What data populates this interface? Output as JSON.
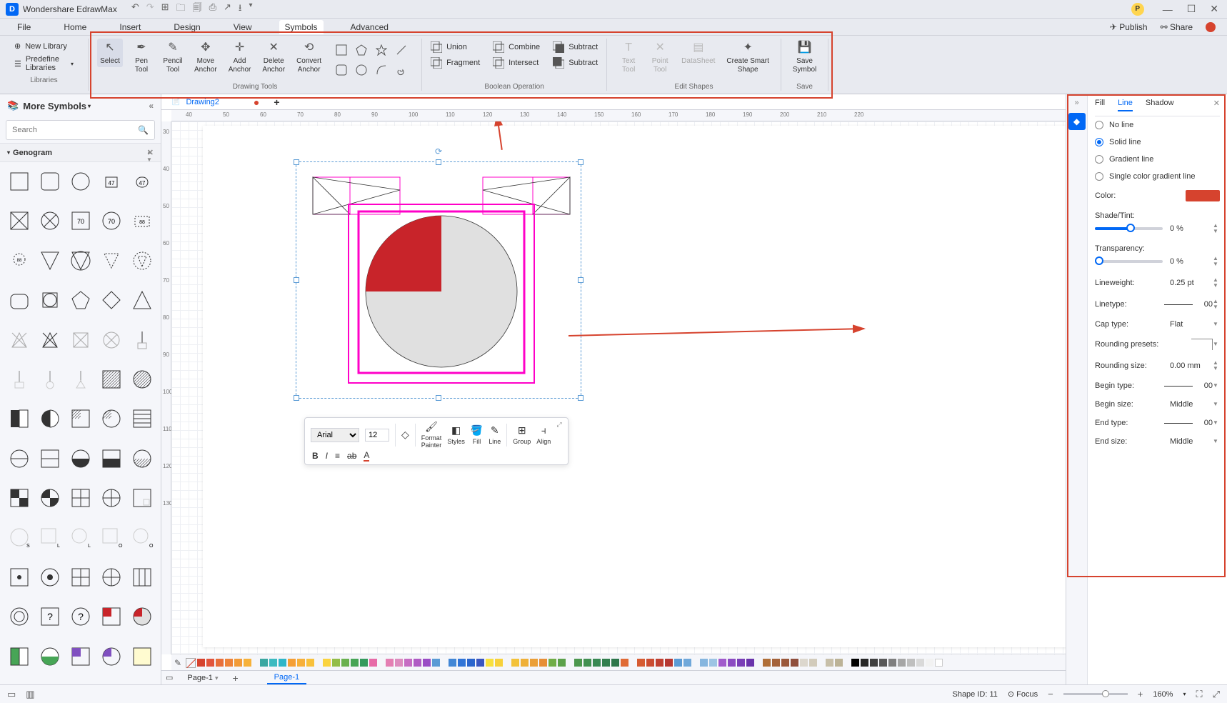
{
  "app": {
    "title": "Wondershare EdrawMax"
  },
  "menu": {
    "items": [
      "File",
      "Home",
      "Insert",
      "Design",
      "View",
      "Symbols",
      "Advanced"
    ],
    "active": "Symbols",
    "publish": "Publish",
    "share": "Share"
  },
  "lib_sidebar": {
    "new_library": "New Library",
    "predefine": "Predefine Libraries",
    "group": "Libraries"
  },
  "ribbon": {
    "drawing_group": "Drawing Tools",
    "bool_group": "Boolean Operation",
    "edit_group": "Edit Shapes",
    "save_group": "Save",
    "select": "Select",
    "pen": "Pen\nTool",
    "pencil": "Pencil\nTool",
    "move_anchor": "Move\nAnchor",
    "add_anchor": "Add\nAnchor",
    "delete_anchor": "Delete\nAnchor",
    "convert_anchor": "Convert\nAnchor",
    "union": "Union",
    "combine": "Combine",
    "subtract1": "Subtract",
    "fragment": "Fragment",
    "intersect": "Intersect",
    "subtract2": "Subtract",
    "text_tool": "Text\nTool",
    "point_tool": "Point\nTool",
    "datasheet": "DataSheet",
    "smart_shape": "Create Smart\nShape",
    "save_symbol": "Save\nSymbol"
  },
  "left": {
    "title": "More Symbols",
    "search_placeholder": "Search",
    "section": "Genogram"
  },
  "doc": {
    "tab": "Drawing2"
  },
  "ruler_h": [
    "40",
    "50",
    "60",
    "70",
    "80",
    "90",
    "100",
    "110",
    "120",
    "130",
    "140",
    "150",
    "160",
    "170",
    "180",
    "190",
    "200",
    "210",
    "220"
  ],
  "ruler_v": [
    "30",
    "40",
    "50",
    "60",
    "70",
    "80",
    "90",
    "100",
    "110",
    "120",
    "130"
  ],
  "float": {
    "font": "Arial",
    "size": "12",
    "format_painter": "Format\nPainter",
    "styles": "Styles",
    "fill": "Fill",
    "line": "Line",
    "group": "Group",
    "align": "Align"
  },
  "pages": {
    "menu": "Page-1",
    "active": "Page-1"
  },
  "right": {
    "tabs": {
      "fill": "Fill",
      "line": "Line",
      "shadow": "Shadow"
    },
    "no_line": "No line",
    "solid": "Solid line",
    "gradient": "Gradient line",
    "single_grad": "Single color gradient line",
    "color": "Color:",
    "shade": "Shade/Tint:",
    "shade_val": "0 %",
    "transparency": "Transparency:",
    "trans_val": "0 %",
    "lineweight": "Lineweight:",
    "lineweight_val": "0.25 pt",
    "linetype": "Linetype:",
    "linetype_val": "00",
    "cap": "Cap type:",
    "cap_val": "Flat",
    "rounding_presets": "Rounding presets:",
    "rounding_size": "Rounding size:",
    "rounding_size_val": "0.00 mm",
    "begin_type": "Begin type:",
    "begin_type_val": "00",
    "begin_size": "Begin size:",
    "begin_size_val": "Middle",
    "end_type": "End type:",
    "end_type_val": "00",
    "end_size": "End size:",
    "end_size_val": "Middle"
  },
  "status": {
    "shape_id": "Shape ID: 11",
    "focus": "Focus",
    "zoom": "160%"
  },
  "colors": {
    "palette": [
      "#d6432e",
      "#e2553c",
      "#e86f3a",
      "#ee8339",
      "#f29b38",
      "#f6b13a",
      "#3aa7a1",
      "#3bbac0",
      "#2fb6c8",
      "#f59f36",
      "#f7b03a",
      "#f8c13c",
      "#fad340",
      "#93bd48",
      "#6ab14f",
      "#47a556",
      "#349a5d",
      "#e76ba7",
      "#e47fb3",
      "#dd8cbf",
      "#c66cc3",
      "#b05bc4",
      "#9a4cc5",
      "#5b9bd5",
      "#4287d6",
      "#3074d7",
      "#2a65cd",
      "#3a56c0",
      "#f8e03e",
      "#f7d13b",
      "#f3c23a",
      "#efb038",
      "#eb9f37",
      "#e78e36",
      "#70ad47",
      "#5ca14a",
      "#4c974e",
      "#419051",
      "#398953",
      "#327f4e",
      "#2d764a",
      "#e06b35",
      "#d65b32",
      "#cb4c31",
      "#c04031",
      "#b63832",
      "#5b9bd5",
      "#70a8da",
      "#86b6df",
      "#9cc4e4",
      "#a15bcc",
      "#8c4bc2",
      "#7a3eb7",
      "#6a33ab",
      "#b06f38",
      "#a5633a",
      "#9a583b",
      "#8f4e3c",
      "#dcd7cd",
      "#d2cbbb",
      "#c7bfa9",
      "#bcb397"
    ],
    "grays": [
      "#000",
      "#262626",
      "#404040",
      "#595959",
      "#7f7f7f",
      "#a6a6a6",
      "#bfbfbf",
      "#d9d9d9",
      "#f2f2f2",
      "#fff"
    ]
  }
}
